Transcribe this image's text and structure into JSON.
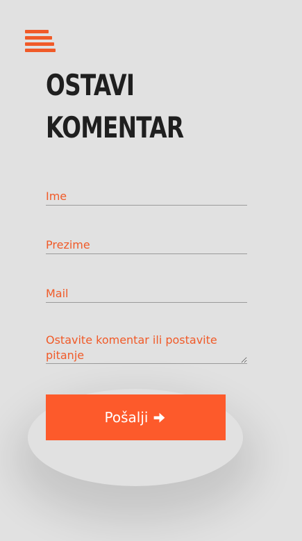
{
  "menu": {
    "icon": "hamburger-menu-icon"
  },
  "title": {
    "line1": "OSTAVI",
    "line2": "KOMENTAR"
  },
  "form": {
    "first_name_placeholder": "Ime",
    "last_name_placeholder": "Prezime",
    "mail_placeholder": "Mail",
    "comment_placeholder": "Ostavite komentar ili postavite pitanje"
  },
  "send_button": {
    "label": "Pošalji",
    "icon": "arrow-right-icon"
  },
  "colors": {
    "accent": "#f05a28",
    "button": "#fd5a2b",
    "background": "#e1e1e1",
    "title": "#1f1f1f"
  }
}
